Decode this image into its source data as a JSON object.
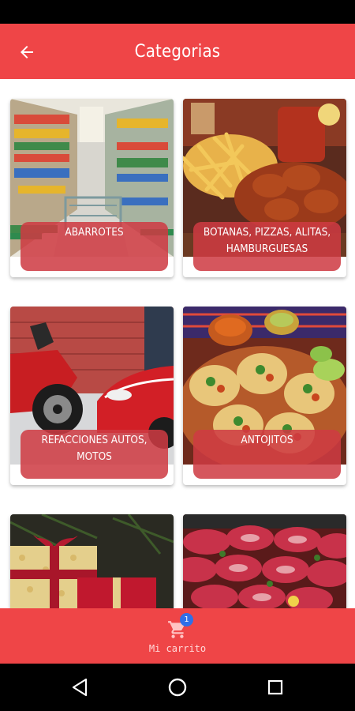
{
  "app_bar": {
    "title": "Categorias"
  },
  "categories": [
    {
      "label": "ABARROTES"
    },
    {
      "label": "BOTANAS, PIZZAS, ALITAS, HAMBURGUESAS"
    },
    {
      "label": "REFACCIONES AUTOS, MOTOS"
    },
    {
      "label": "ANTOJITOS"
    },
    {
      "label": ""
    },
    {
      "label": ""
    }
  ],
  "bottom_nav": {
    "cart_label": "Mi carrito",
    "cart_badge": "1"
  },
  "icons": {
    "back": "arrow-left-icon",
    "cart": "shopping-cart-icon",
    "system_back": "triangle-back-icon",
    "system_home": "circle-home-icon",
    "system_recents": "square-recents-icon"
  },
  "colors": {
    "primary": "#ef4547",
    "label_overlay": "#ce3a42",
    "badge": "#2f6fe8"
  }
}
